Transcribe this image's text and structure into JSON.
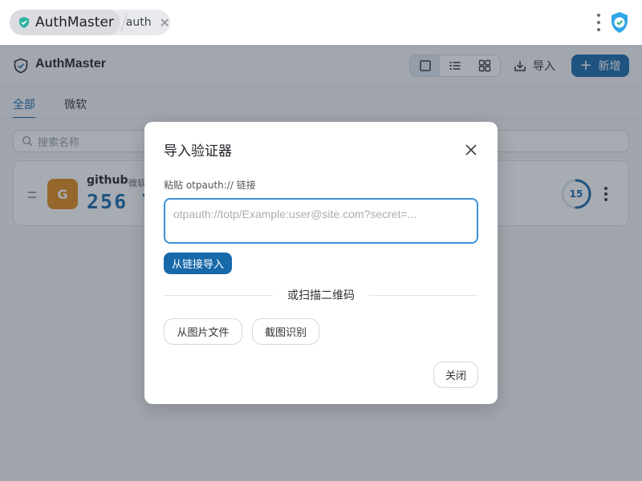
{
  "browser": {
    "extension_name": "AuthMaster",
    "tab_label": "auth"
  },
  "app": {
    "title": "AuthMaster",
    "import_label": "导入",
    "add_label": "新增",
    "tabs": [
      {
        "label": "全部",
        "active": true
      },
      {
        "label": "微软",
        "active": false
      }
    ],
    "search_placeholder": "搜索名称",
    "accent_color": "#1769aa"
  },
  "accounts": [
    {
      "avatar_letter": "G",
      "avatar_color": "#e08a19",
      "name": "github",
      "issuer": "微软",
      "code": "256 7",
      "seconds_remaining": 15,
      "period": 30
    }
  ],
  "modal": {
    "title": "导入验证器",
    "uri_label": "粘贴 otpauth:// 链接",
    "uri_value": "",
    "uri_placeholder": "otpauth://totp/Example:user@site.com?secret=...",
    "import_link_button": "从链接导入",
    "or_scan_label": "或扫描二维码",
    "from_image_button": "从图片文件",
    "screenshot_button": "截图识别",
    "close_button": "关闭"
  }
}
